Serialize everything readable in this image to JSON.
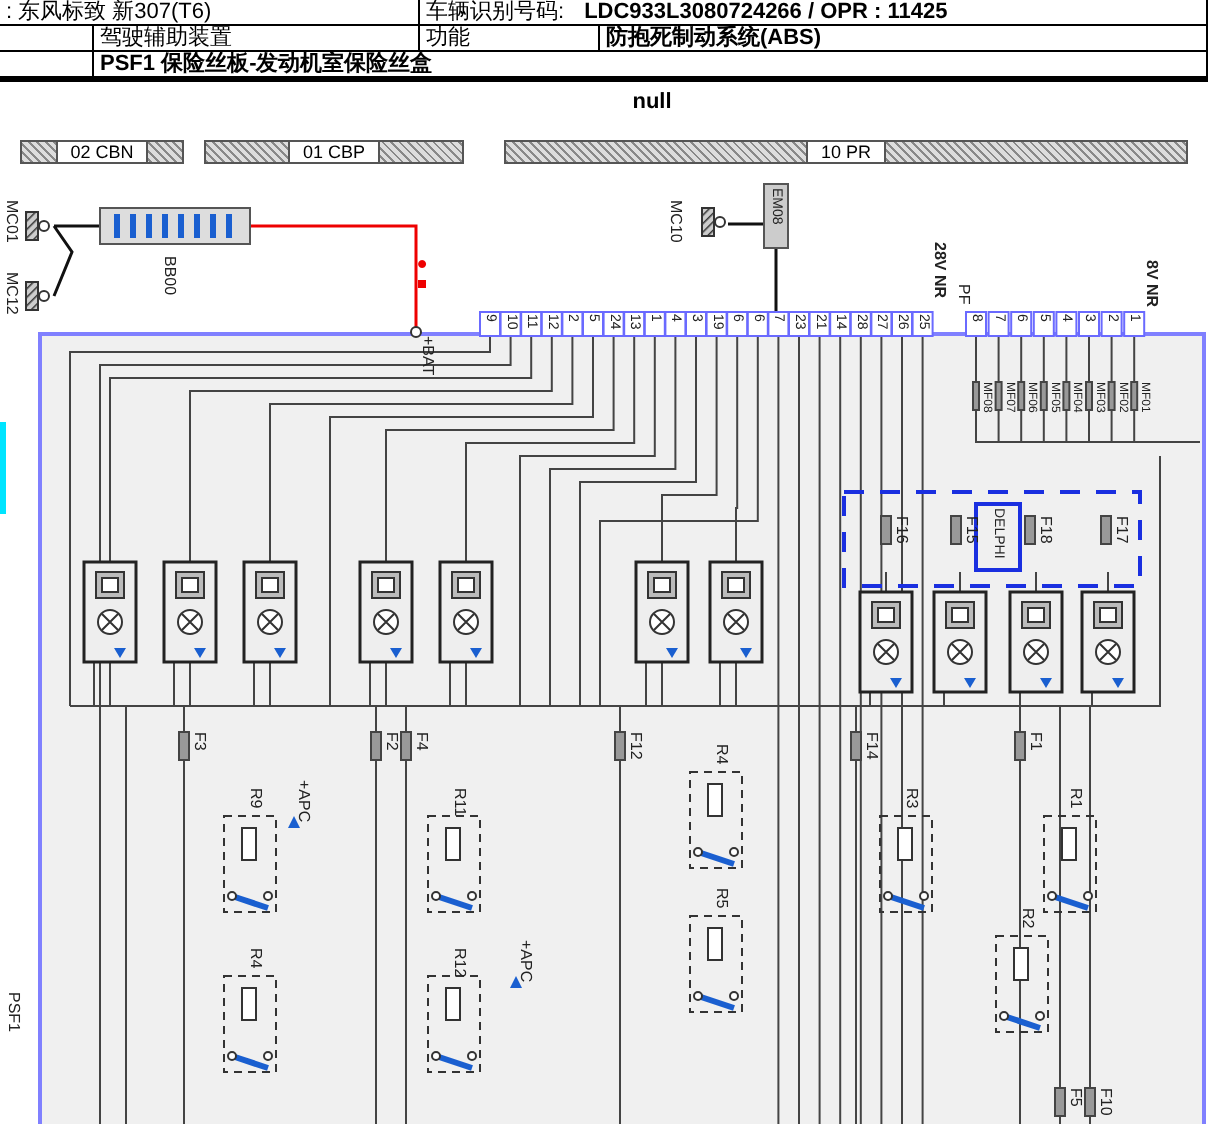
{
  "header": {
    "model": ": 东风标致 新307(T6)",
    "vin_label": "车辆识别号码:",
    "vin_value": "LDC933L3080724266 / OPR : 11425",
    "system": "驾驶辅助装置",
    "function_label": "功能",
    "function_value": "防抱死制动系统(ABS)",
    "component": "PSF1 保险丝板-发动机室保险丝盒"
  },
  "caption": "null",
  "connector_bars": [
    {
      "label": "02 CBN"
    },
    {
      "label": "01 CBP"
    },
    {
      "label": "10 PR"
    }
  ],
  "diagram": {
    "grounds": [
      "MC01",
      "MC12"
    ],
    "battery": "BB00",
    "bat_label": "+BAT",
    "relay_ground": "MC10",
    "ecu": "EM08",
    "fuse_box_pins": [
      "9",
      "10",
      "11",
      "12",
      "2",
      "5",
      "24",
      "13",
      "1",
      "4",
      "3",
      "19",
      "6",
      "6",
      "7",
      "23",
      "21",
      "14",
      "28",
      "27",
      "26",
      "25"
    ],
    "module_pins": [
      "8",
      "7",
      "6",
      "5",
      "4",
      "3",
      "2",
      "1"
    ],
    "module_labels": [
      "28V NR",
      "PF",
      "8V NR"
    ],
    "mf_fuses": [
      "MF08",
      "MF07",
      "MF06",
      "MF05",
      "MF04",
      "MF03",
      "MF02",
      "MF01"
    ],
    "fuses": [
      "F16",
      "F15",
      "F18",
      "F17",
      "F3",
      "F2",
      "F4",
      "F12",
      "F14",
      "F1",
      "F5",
      "F10"
    ],
    "delphi": "DELPHI",
    "relays": [
      "R9",
      "R11",
      "R4",
      "R12",
      "R4",
      "R5",
      "R3",
      "R1",
      "R2"
    ],
    "apc": [
      "+APC",
      "+APC"
    ],
    "side_label": "PSF1"
  }
}
